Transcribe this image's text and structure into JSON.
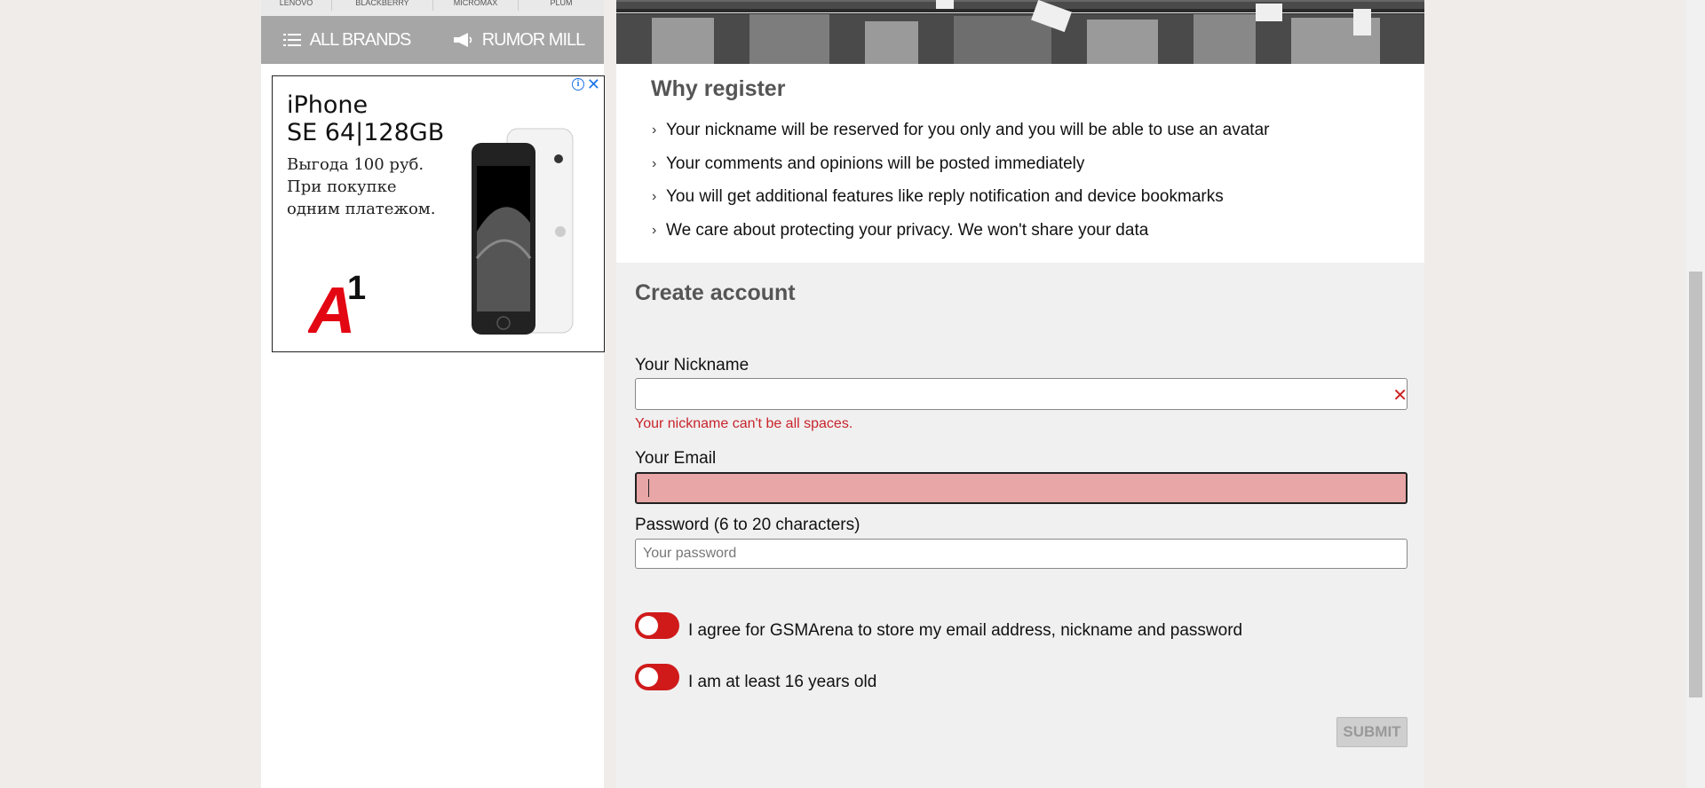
{
  "sidebar": {
    "brands_strip": [
      "LENOVO",
      "BLACKBERRY",
      "MICROMAX",
      "PLUM"
    ],
    "nav": {
      "all_brands": "ALL BRANDS",
      "rumor_mill": "RUMOR MILL"
    },
    "ad": {
      "title_line1": "iPhone",
      "title_line2": "SE 64|128GB",
      "sub_line1": "Выгода 100 руб.",
      "sub_line2": "При покупке",
      "sub_line3": "одним платежом.",
      "logo_text": "A",
      "logo_super": "1",
      "info_icon": "i",
      "close_icon": "✕",
      "accent": "#e30613"
    }
  },
  "why_register": {
    "title": "Why register",
    "items": [
      "Your nickname will be reserved for you only and you will be able to use an avatar",
      "Your comments and opinions will be posted immediately",
      "You will get additional features like reply notification and device bookmarks",
      "We care about protecting your privacy. We won't share your data"
    ]
  },
  "create_account": {
    "title": "Create account",
    "nickname_label": "Your Nickname",
    "nickname_value": "",
    "nickname_error": "Your nickname can't be all spaces.",
    "clear_icon": "✕",
    "email_label": "Your Email",
    "email_value": "",
    "password_label": "Password (6 to 20 characters)",
    "password_placeholder": "Your password",
    "agree_label": "I agree for GSMArena to store my email address, nickname and password",
    "age_label": "I am at least 16 years old",
    "submit_label": "SUBMIT"
  },
  "colors": {
    "toggle_on": "#d01a1a",
    "error_text": "#c8242b",
    "error_field_bg": "#e8a6a6"
  }
}
